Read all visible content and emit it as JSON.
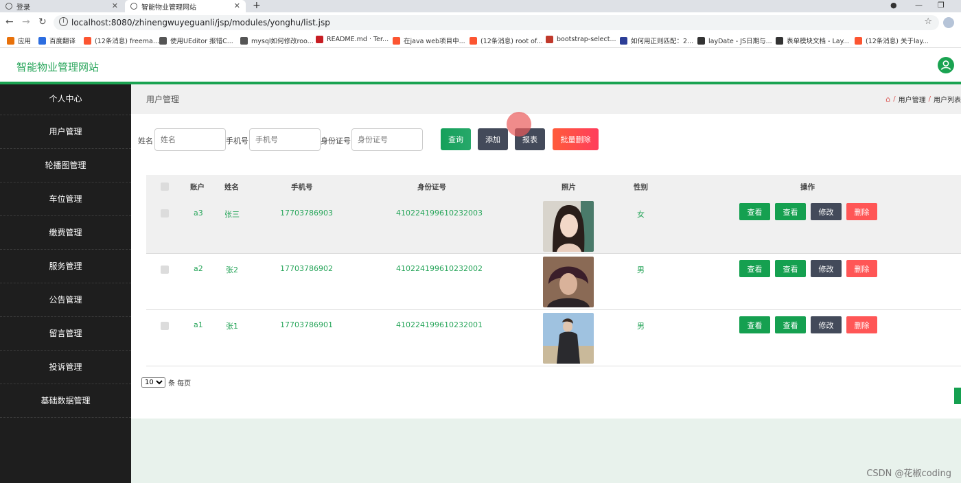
{
  "browser": {
    "tabs": [
      {
        "label": "登录"
      },
      {
        "label": "智能物业管理网站"
      }
    ],
    "url": "localhost:8080/zhinengwuyeguanli/jsp/modules/yonghu/list.jsp",
    "bookmarks": [
      {
        "label": "应用",
        "color": "#e8710a"
      },
      {
        "label": "百度翻译",
        "color": "#2c6de0"
      },
      {
        "label": "(12条消息) freema...",
        "color": "#fc5531"
      },
      {
        "label": "使用UEditor 报错C...",
        "color": "#555555"
      },
      {
        "label": "mysql如何修改roo...",
        "color": "#555555"
      },
      {
        "label": "README.md · Ter...",
        "color": "#c71d23"
      },
      {
        "label": "在java web项目中...",
        "color": "#fc5531"
      },
      {
        "label": "(12条消息) root of...",
        "color": "#fc5531"
      },
      {
        "label": "bootstrap-select...",
        "color": "#c0392b"
      },
      {
        "label": "如何用正则匹配：2...",
        "color": "#2c3e97"
      },
      {
        "label": "layDate - JS日期与...",
        "color": "#333333"
      },
      {
        "label": "表单模块文档 - Lay...",
        "color": "#333333"
      },
      {
        "label": "(12条消息) 关于lay...",
        "color": "#fc5531"
      }
    ]
  },
  "app": {
    "brand": "智能物业管理网站",
    "accent": "#1aa351"
  },
  "sidebar": {
    "items": [
      {
        "label": "个人中心"
      },
      {
        "label": "用户管理"
      },
      {
        "label": "轮播图管理"
      },
      {
        "label": "车位管理"
      },
      {
        "label": "缴费管理"
      },
      {
        "label": "服务管理"
      },
      {
        "label": "公告管理"
      },
      {
        "label": "留言管理"
      },
      {
        "label": "投诉管理"
      },
      {
        "label": "基础数据管理"
      }
    ]
  },
  "page": {
    "title": "用户管理",
    "breadcrumb": [
      "用户管理",
      "用户列表"
    ]
  },
  "search": {
    "name_label": "姓名",
    "name_placeholder": "姓名",
    "phone_label": "手机号",
    "phone_placeholder": "手机号",
    "idcard_label": "身份证号",
    "idcard_placeholder": "身份证号",
    "query_label": "查询",
    "add_label": "添加",
    "report_label": "报表",
    "batch_delete_label": "批量删除"
  },
  "table": {
    "headers": {
      "account": "账户",
      "name": "姓名",
      "phone": "手机号",
      "idcard": "身份证号",
      "photo": "照片",
      "gender": "性别",
      "actions": "操作"
    },
    "action_labels": {
      "view1": "查看",
      "view2": "查看",
      "edit": "修改",
      "delete": "删除"
    },
    "rows": [
      {
        "account": "a3",
        "name": "张三",
        "phone": "17703786903",
        "idcard": "410224199610232003",
        "gender": "女"
      },
      {
        "account": "a2",
        "name": "张2",
        "phone": "17703786902",
        "idcard": "410224199610232002",
        "gender": "男"
      },
      {
        "account": "a1",
        "name": "张1",
        "phone": "17703786901",
        "idcard": "410224199610232001",
        "gender": "男"
      }
    ]
  },
  "pager": {
    "page_size": "10",
    "suffix": "条 每页"
  },
  "watermark": "CSDN @花椒coding"
}
